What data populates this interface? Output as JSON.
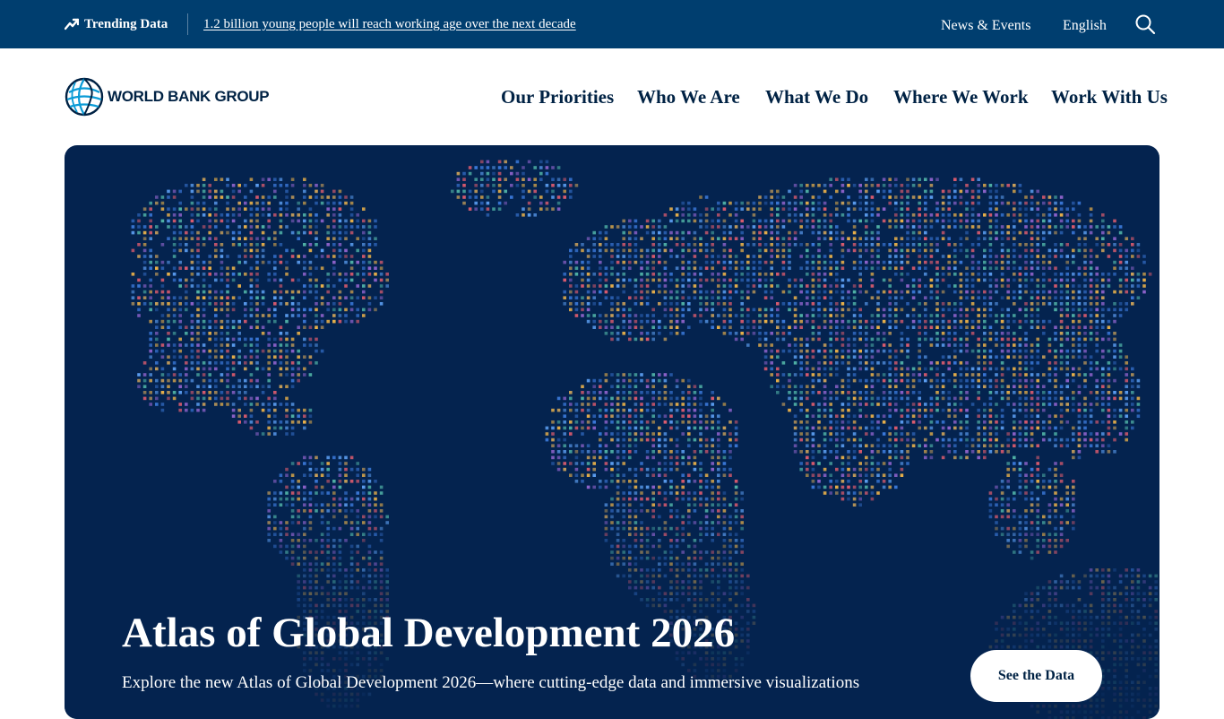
{
  "topbar": {
    "trending_label": "Trending Data",
    "trending_link": "1.2 billion young people will reach working age over the next decade",
    "news_events": "News & Events",
    "language": "English",
    "icons": {
      "trend": "trending-up-icon",
      "search": "search-icon"
    }
  },
  "header": {
    "logo_text": "WORLD BANK GROUP",
    "nav": [
      "Our Priorities",
      "Who We Are",
      "What We Do",
      "Where We Work",
      "Work With Us"
    ]
  },
  "hero": {
    "title": "Atlas of Global Development 2026",
    "description": "Explore the new Atlas of Global Development 2026—where cutting-edge data and immersive visualizations",
    "cta_label": "See the Data"
  },
  "colors": {
    "topbar_bg": "#003e6f",
    "brand_navy": "#002244",
    "hero_bg": "#04234f",
    "logo_blue": "#0a9bd6",
    "dot_palette": [
      "#e8b04a",
      "#3a78d8",
      "#5b9df0",
      "#8c62c9",
      "#d95b6e",
      "#4fb0a5",
      "#c9a05a",
      "#2b5fb0"
    ]
  }
}
